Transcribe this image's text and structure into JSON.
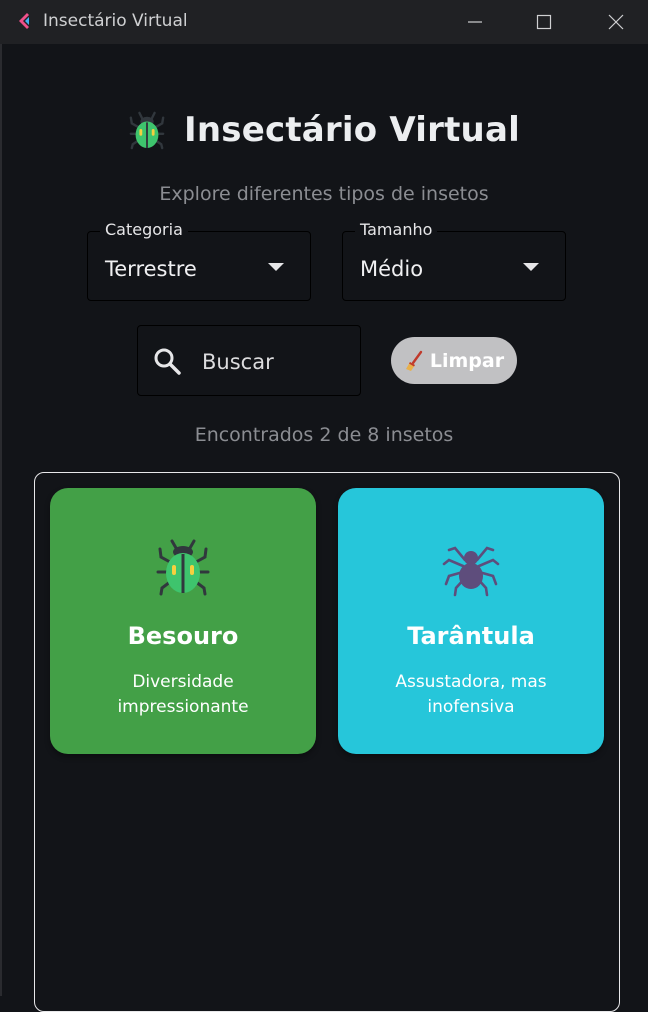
{
  "window": {
    "title": "Insectário Virtual"
  },
  "header": {
    "title": "Insectário Virtual",
    "subtitle": "Explore diferentes tipos de insetos"
  },
  "filters": {
    "category": {
      "label": "Categoria",
      "value": "Terrestre"
    },
    "size": {
      "label": "Tamanho",
      "value": "Médio"
    }
  },
  "search": {
    "placeholder": "Buscar",
    "value": ""
  },
  "clear_button": {
    "label": "Limpar"
  },
  "results": {
    "summary": "Encontrados 2 de 8 insetos"
  },
  "insects": [
    {
      "name": "Besouro",
      "description": "Diversidade impressionante",
      "color": "#43a047",
      "icon": "beetle-icon"
    },
    {
      "name": "Tarântula",
      "description": "Assustadora, mas inofensiva",
      "color": "#26c6da",
      "icon": "spider-icon"
    }
  ]
}
